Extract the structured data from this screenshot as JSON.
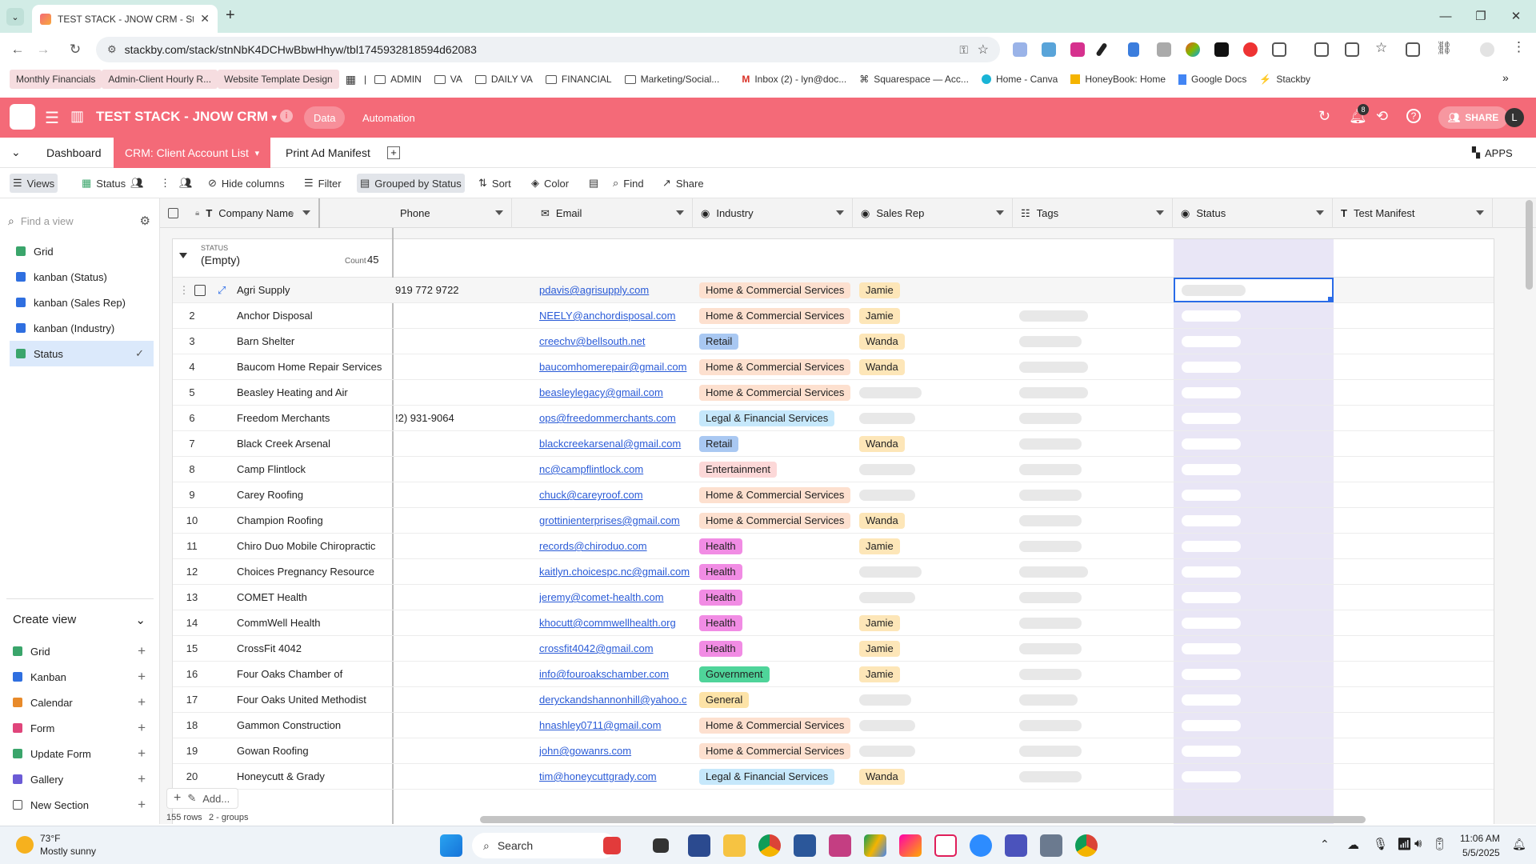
{
  "browser": {
    "tab_title": "TEST STACK - JNOW CRM - Sta",
    "url": "stackby.com/stack/stnNbK4DCHwBbwHhyw/tbl1745932818594d62083",
    "bookmarks": [
      {
        "label": "Monthly Financials",
        "type": "highlight"
      },
      {
        "label": "Admin-Client Hourly R...",
        "type": "plain"
      },
      {
        "label": "Website Template Design",
        "type": "highlight"
      },
      {
        "label": "ADMIN",
        "type": "folder"
      },
      {
        "label": "VA",
        "type": "folder"
      },
      {
        "label": "DAILY VA",
        "type": "folder"
      },
      {
        "label": "FINANCIAL",
        "type": "folder"
      },
      {
        "label": "Marketing/Social...",
        "type": "folder"
      },
      {
        "label": "Inbox (2) - lyn@doc...",
        "type": "gmail"
      },
      {
        "label": "Squarespace — Acc...",
        "type": "squarespace"
      },
      {
        "label": "Home - Canva",
        "type": "canva"
      },
      {
        "label": "HoneyBook: Home",
        "type": "honeybook"
      },
      {
        "label": "Google Docs",
        "type": "docs"
      },
      {
        "label": "Stackby",
        "type": "stackby"
      }
    ]
  },
  "app": {
    "stack_name": "TEST STACK - JNOW CRM",
    "nav_data": "Data",
    "nav_automation": "Automation",
    "notification_count": "8",
    "share_label": "SHARE",
    "avatar_letter": "L",
    "accent_color": "#f46a78"
  },
  "tabs": {
    "dashboard": "Dashboard",
    "client_list": "CRM: Client Account List",
    "print_manifest": "Print Ad Manifest",
    "apps": "APPS"
  },
  "toolbar": {
    "views": "Views",
    "current_view": "Status",
    "hide_columns": "Hide columns",
    "filter": "Filter",
    "grouped_by": "Grouped by Status",
    "sort": "Sort",
    "color": "Color",
    "find": "Find",
    "share": "Share"
  },
  "sidebar": {
    "find_placeholder": "Find a view",
    "views": [
      {
        "label": "Grid",
        "icon": "grid-icon"
      },
      {
        "label": "kanban (Status)",
        "icon": "kanban-icon"
      },
      {
        "label": "kanban (Sales Rep)",
        "icon": "kanban-icon"
      },
      {
        "label": "kanban (Industry)",
        "icon": "kanban-icon"
      },
      {
        "label": "Status",
        "icon": "grid-icon",
        "active": true
      }
    ],
    "create_view_title": "Create view",
    "create_items": [
      {
        "label": "Grid",
        "color": "#3aa56b"
      },
      {
        "label": "Kanban",
        "color": "#2f6fe0"
      },
      {
        "label": "Calendar",
        "color": "#e88a2a"
      },
      {
        "label": "Form",
        "color": "#e0457b"
      },
      {
        "label": "Update Form",
        "color": "#3aa56b"
      },
      {
        "label": "Gallery",
        "color": "#6b5bd6"
      },
      {
        "label": "New Section",
        "color": "#555555"
      }
    ]
  },
  "columns": {
    "company": "Company Name",
    "phone": "Phone",
    "email": "Email",
    "industry": "Industry",
    "sales_rep": "Sales Rep",
    "tags": "Tags",
    "status": "Status",
    "test_manifest": "Test Manifest"
  },
  "group": {
    "field": "STATUS",
    "value": "(Empty)",
    "count_label": "Count",
    "count": "45"
  },
  "rows": [
    {
      "n": "",
      "company": "Agri Supply",
      "phone": "919 772 9722",
      "email": "pdavis@agrisupply.com",
      "industry": "Home & Commercial Services",
      "rep": "Jamie"
    },
    {
      "n": "2",
      "company": "Anchor Disposal",
      "phone": "",
      "email": "NEELY@anchordisposal.com",
      "industry": "Home & Commercial Services",
      "rep": "Jamie"
    },
    {
      "n": "3",
      "company": "Barn Shelter",
      "phone": "",
      "email": "creechv@bellsouth.net",
      "industry": "Retail",
      "rep": "Wanda"
    },
    {
      "n": "4",
      "company": "Baucom Home Repair Services",
      "phone": "",
      "email": "baucomhomerepair@gmail.com",
      "industry": "Home & Commercial Services",
      "rep": "Wanda"
    },
    {
      "n": "5",
      "company": "Beasley Heating and Air",
      "phone": "",
      "email": "beasleylegacy@gmail.com",
      "industry": "Home & Commercial Services",
      "rep": ""
    },
    {
      "n": "6",
      "company": "Freedom Merchants",
      "phone": "!2) 931-9064",
      "email": "ops@freedommerchants.com",
      "industry": "Legal & Financial Services",
      "rep": ""
    },
    {
      "n": "7",
      "company": "Black Creek Arsenal",
      "phone": "",
      "email": "blackcreekarsenal@gmail.com",
      "industry": "Retail",
      "rep": "Wanda"
    },
    {
      "n": "8",
      "company": "Camp Flintlock",
      "phone": "",
      "email": "nc@campflintlock.com",
      "industry": "Entertainment",
      "rep": ""
    },
    {
      "n": "9",
      "company": "Carey Roofing",
      "phone": "",
      "email": "chuck@careyroof.com",
      "industry": "Home & Commercial Services",
      "rep": ""
    },
    {
      "n": "10",
      "company": "Champion Roofing",
      "phone": "",
      "email": "grottinienterprises@gmail.com",
      "industry": "Home & Commercial Services",
      "rep": "Wanda"
    },
    {
      "n": "11",
      "company": "Chiro Duo Mobile Chiropractic",
      "phone": "",
      "email": "records@chiroduo.com",
      "industry": "Health",
      "rep": "Jamie"
    },
    {
      "n": "12",
      "company": "Choices Pregnancy Resource",
      "phone": "",
      "email": "kaitlyn.choicespc.nc@gmail.com",
      "industry": "Health",
      "rep": ""
    },
    {
      "n": "13",
      "company": "COMET Health",
      "phone": "",
      "email": "jeremy@comet-health.com",
      "industry": "Health",
      "rep": ""
    },
    {
      "n": "14",
      "company": "CommWell Health",
      "phone": "",
      "email": "khocutt@commwellhealth.org",
      "industry": "Health",
      "rep": "Jamie"
    },
    {
      "n": "15",
      "company": "CrossFit 4042",
      "phone": "",
      "email": "crossfit4042@gmail.com",
      "industry": "Health",
      "rep": "Jamie"
    },
    {
      "n": "16",
      "company": "Four Oaks Chamber of",
      "phone": "",
      "email": "info@fouroakschamber.com",
      "industry": "Government",
      "rep": "Jamie"
    },
    {
      "n": "17",
      "company": "Four Oaks United Methodist",
      "phone": "",
      "email": "deryckandshannonhill@yahoo.c",
      "industry": "General",
      "rep": ""
    },
    {
      "n": "18",
      "company": "Gammon Construction",
      "phone": "",
      "email": "hnashley0711@gmail.com",
      "industry": "Home & Commercial Services",
      "rep": ""
    },
    {
      "n": "19",
      "company": "Gowan Roofing",
      "phone": "",
      "email": "john@gowanrs.com",
      "industry": "Home & Commercial Services",
      "rep": ""
    },
    {
      "n": "20",
      "company": "Honeycutt & Grady",
      "phone": "",
      "email": "tim@honeycuttgrady.com",
      "industry": "Legal & Financial Services",
      "rep": "Wanda"
    }
  ],
  "industry_colors": {
    "Home & Commercial Services": "#fde0cf",
    "Retail": "#a9c8f2",
    "Legal & Financial Services": "#c6e8fb",
    "Entertainment": "#fcd8d8",
    "Health": "#f18ce4",
    "Government": "#4fd49a",
    "General": "#fde3a7"
  },
  "rep_color": "#fde6b8",
  "footer": {
    "add_label": "Add...",
    "row_count": "155 rows",
    "group_count": "2 - groups"
  },
  "taskbar": {
    "temp": "73°F",
    "weather": "Mostly sunny",
    "search": "Search",
    "time": "11:06 AM",
    "date": "5/5/2025"
  }
}
